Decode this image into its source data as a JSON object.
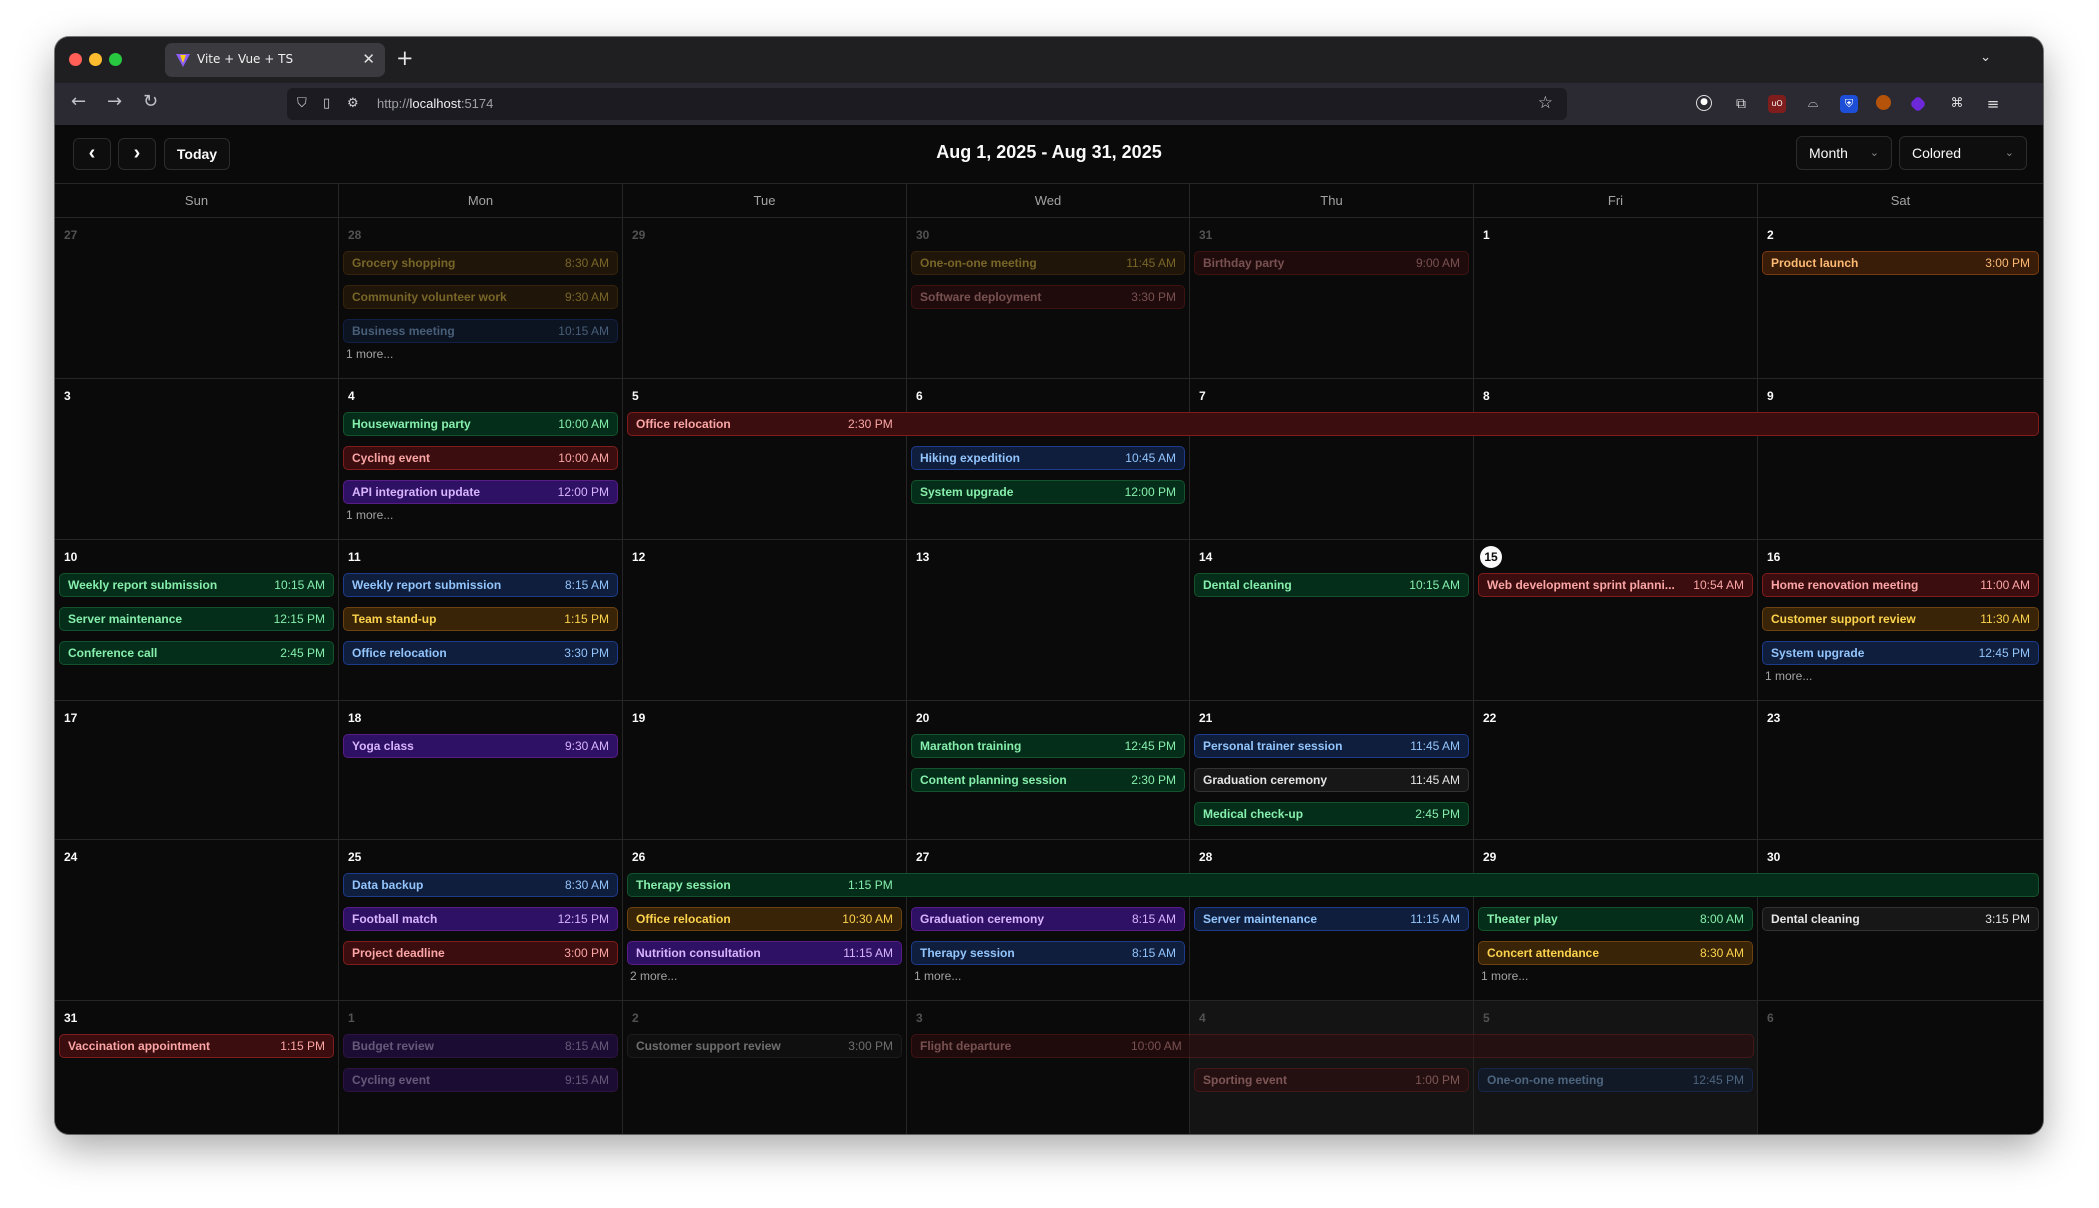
{
  "browser": {
    "tab_title": "Vite + Vue + TS",
    "url_prefix": "http://",
    "url_host": "localhost",
    "url_port": ":5174"
  },
  "toolbar": {
    "prev_icon": "‹",
    "next_icon": "›",
    "today_label": "Today",
    "range_title": "Aug 1, 2025 - Aug 31, 2025",
    "view_select": "Month",
    "color_select": "Colored"
  },
  "weekdays": [
    "Sun",
    "Mon",
    "Tue",
    "Wed",
    "Thu",
    "Fri",
    "Sat"
  ],
  "weeks": [
    [
      {
        "day": "27",
        "other": true
      },
      {
        "day": "28",
        "other": true,
        "events": [
          {
            "title": "Grocery shopping",
            "time": "8:30 AM",
            "color": "amber"
          },
          {
            "title": "Community volunteer work",
            "time": "9:30 AM",
            "color": "amber"
          },
          {
            "title": "Business meeting",
            "time": "10:15 AM",
            "color": "blue"
          }
        ],
        "more": "1 more..."
      },
      {
        "day": "29",
        "other": true
      },
      {
        "day": "30",
        "other": true,
        "events": [
          {
            "title": "One-on-one meeting",
            "time": "11:45 AM",
            "color": "amber"
          },
          {
            "title": "Software deployment",
            "time": "3:30 PM",
            "color": "red"
          }
        ]
      },
      {
        "day": "31",
        "other": true,
        "events": [
          {
            "title": "Birthday party",
            "time": "9:00 AM",
            "color": "red"
          }
        ]
      },
      {
        "day": "1"
      },
      {
        "day": "2",
        "events": [
          {
            "title": "Product launch",
            "time": "3:00 PM",
            "color": "orange"
          }
        ]
      }
    ],
    [
      {
        "day": "3"
      },
      {
        "day": "4",
        "events": [
          {
            "title": "Housewarming party",
            "time": "10:00 AM",
            "color": "green"
          },
          {
            "title": "Cycling event",
            "time": "10:00 AM",
            "color": "red"
          },
          {
            "title": "API integration update",
            "time": "12:00 PM",
            "color": "purple"
          }
        ],
        "more": "1 more..."
      },
      {
        "day": "5"
      },
      {
        "day": "6",
        "events": [
          {
            "title": "Hiking expedition",
            "time": "10:45 AM",
            "color": "blue",
            "slot": 1
          },
          {
            "title": "System upgrade",
            "time": "12:00 PM",
            "color": "green",
            "slot": 2
          }
        ]
      },
      {
        "day": "7"
      },
      {
        "day": "8"
      },
      {
        "day": "9"
      }
    ],
    [
      {
        "day": "10",
        "events": [
          {
            "title": "Weekly report submission",
            "time": "10:15 AM",
            "color": "green"
          },
          {
            "title": "Server maintenance",
            "time": "12:15 PM",
            "color": "green"
          },
          {
            "title": "Conference call",
            "time": "2:45 PM",
            "color": "green"
          }
        ]
      },
      {
        "day": "11",
        "events": [
          {
            "title": "Weekly report submission",
            "time": "8:15 AM",
            "color": "blue"
          },
          {
            "title": "Team stand-up",
            "time": "1:15 PM",
            "color": "amber"
          },
          {
            "title": "Office relocation",
            "time": "3:30 PM",
            "color": "blue"
          }
        ]
      },
      {
        "day": "12"
      },
      {
        "day": "13"
      },
      {
        "day": "14",
        "events": [
          {
            "title": "Dental cleaning",
            "time": "10:15 AM",
            "color": "green"
          }
        ]
      },
      {
        "day": "15",
        "today": true,
        "events": [
          {
            "title": "Web development sprint planni...",
            "time": "10:54 AM",
            "color": "red"
          }
        ]
      },
      {
        "day": "16",
        "events": [
          {
            "title": "Home renovation meeting",
            "time": "11:00 AM",
            "color": "red"
          },
          {
            "title": "Customer support review",
            "time": "11:30 AM",
            "color": "amber"
          },
          {
            "title": "System upgrade",
            "time": "12:45 PM",
            "color": "blue"
          }
        ],
        "more": "1 more..."
      }
    ],
    [
      {
        "day": "17"
      },
      {
        "day": "18",
        "events": [
          {
            "title": "Yoga class",
            "time": "9:30 AM",
            "color": "purple"
          }
        ]
      },
      {
        "day": "19"
      },
      {
        "day": "20",
        "events": [
          {
            "title": "Marathon training",
            "time": "12:45 PM",
            "color": "green"
          },
          {
            "title": "Content planning session",
            "time": "2:30 PM",
            "color": "green"
          }
        ]
      },
      {
        "day": "21",
        "events": [
          {
            "title": "Personal trainer session",
            "time": "11:45 AM",
            "color": "blue"
          },
          {
            "title": "Graduation ceremony",
            "time": "11:45 AM",
            "color": "neutral"
          },
          {
            "title": "Medical check-up",
            "time": "2:45 PM",
            "color": "green"
          }
        ]
      },
      {
        "day": "22"
      },
      {
        "day": "23"
      }
    ],
    [
      {
        "day": "24"
      },
      {
        "day": "25",
        "events": [
          {
            "title": "Data backup",
            "time": "8:30 AM",
            "color": "blue"
          },
          {
            "title": "Football match",
            "time": "12:15 PM",
            "color": "purple"
          },
          {
            "title": "Project deadline",
            "time": "3:00 PM",
            "color": "red"
          }
        ]
      },
      {
        "day": "26",
        "events": [
          {
            "title": "Office relocation",
            "time": "10:30 AM",
            "color": "amber",
            "slot": 1
          },
          {
            "title": "Nutrition consultation",
            "time": "11:15 AM",
            "color": "purple",
            "slot": 2
          }
        ],
        "more": "2 more..."
      },
      {
        "day": "27",
        "events": [
          {
            "title": "Graduation ceremony",
            "time": "8:15 AM",
            "color": "purple",
            "slot": 1
          },
          {
            "title": "Therapy session",
            "time": "8:15 AM",
            "color": "blue",
            "slot": 2
          }
        ],
        "more": "1 more..."
      },
      {
        "day": "28",
        "events": [
          {
            "title": "Server maintenance",
            "time": "11:15 AM",
            "color": "blue",
            "slot": 1
          }
        ]
      },
      {
        "day": "29",
        "events": [
          {
            "title": "Theater play",
            "time": "8:00 AM",
            "color": "green",
            "slot": 1
          },
          {
            "title": "Concert attendance",
            "time": "8:30 AM",
            "color": "amber",
            "slot": 2
          }
        ],
        "more": "1 more..."
      },
      {
        "day": "30",
        "events": [
          {
            "title": "Dental cleaning",
            "time": "3:15 PM",
            "color": "neutral",
            "slot": 1
          }
        ]
      }
    ],
    [
      {
        "day": "31",
        "events": [
          {
            "title": "Vaccination appointment",
            "time": "1:15 PM",
            "color": "red"
          }
        ]
      },
      {
        "day": "1",
        "other": true,
        "events": [
          {
            "title": "Budget review",
            "time": "8:15 AM",
            "color": "purple"
          },
          {
            "title": "Cycling event",
            "time": "9:15 AM",
            "color": "purple"
          }
        ]
      },
      {
        "day": "2",
        "other": true,
        "events": [
          {
            "title": "Customer support review",
            "time": "3:00 PM",
            "color": "neutral"
          }
        ]
      },
      {
        "day": "3",
        "other": true
      },
      {
        "day": "4",
        "other": true,
        "muted": true,
        "events": [
          {
            "title": "Sporting event",
            "time": "1:00 PM",
            "color": "red",
            "slot": 1
          }
        ]
      },
      {
        "day": "5",
        "other": true,
        "muted": true,
        "events": [
          {
            "title": "One-on-one meeting",
            "time": "12:45 PM",
            "color": "blue",
            "slot": 1
          }
        ]
      },
      {
        "day": "6",
        "other": true
      }
    ]
  ],
  "spanning_events": [
    {
      "week": 1,
      "start": 2,
      "end": 6,
      "title": "Office relocation",
      "time": "2:30 PM",
      "color": "red"
    },
    {
      "week": 4,
      "start": 2,
      "end": 6,
      "title": "Therapy session",
      "time": "1:15 PM",
      "color": "green"
    },
    {
      "week": 5,
      "start": 3,
      "end": 5,
      "title": "Flight departure",
      "time": "10:00 AM",
      "color": "red",
      "dim": true
    }
  ]
}
